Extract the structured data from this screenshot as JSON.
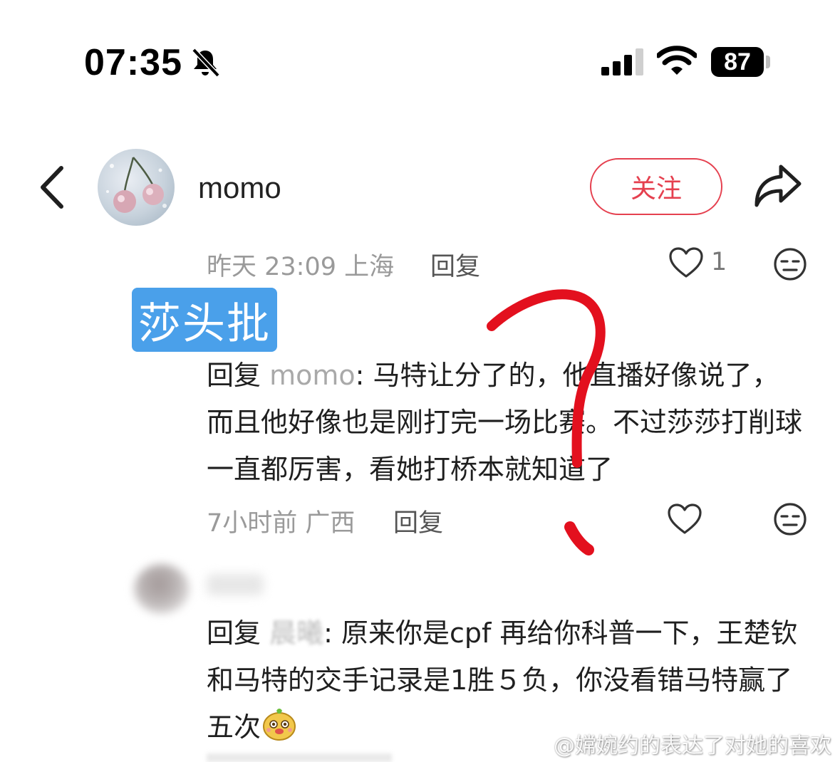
{
  "status_bar": {
    "time": "07:35",
    "battery": "87",
    "icons": [
      "bell-slash-icon",
      "signal-icon",
      "wifi-icon",
      "battery-icon"
    ]
  },
  "header": {
    "username": "momo",
    "follow_label": "关注",
    "icons": [
      "back-icon",
      "share-icon"
    ]
  },
  "post": {
    "time_location": "昨天 23:09 上海",
    "reply_label": "回复",
    "like_count": "1",
    "highlight_tag": "莎头批"
  },
  "comments": [
    {
      "reply_prefix": "回复",
      "mention": "momo",
      "text_after": ": 马特让分了的，他直播好像说了，而且他好像也是刚打完一场比赛。不过莎莎打削球一直都厉害，看她打桥本就知道了",
      "time_location": "7小时前 广西",
      "reply_label": "回复"
    },
    {
      "reply_prefix": "回复",
      "mention": "晨曦",
      "text_after": ": 原来你是cpf 再给你科普一下，王楚钦和马特的交手记录是1胜５负，你没看错马特赢了五次",
      "emoji": "bear-emoji-icon"
    }
  ],
  "watermark": {
    "text": "@嫦婉约的表达了对她的喜欢"
  },
  "colors": {
    "accent_red": "#e5404f",
    "tag_blue": "#4aa0ea",
    "scribble_red": "#e3101e"
  }
}
